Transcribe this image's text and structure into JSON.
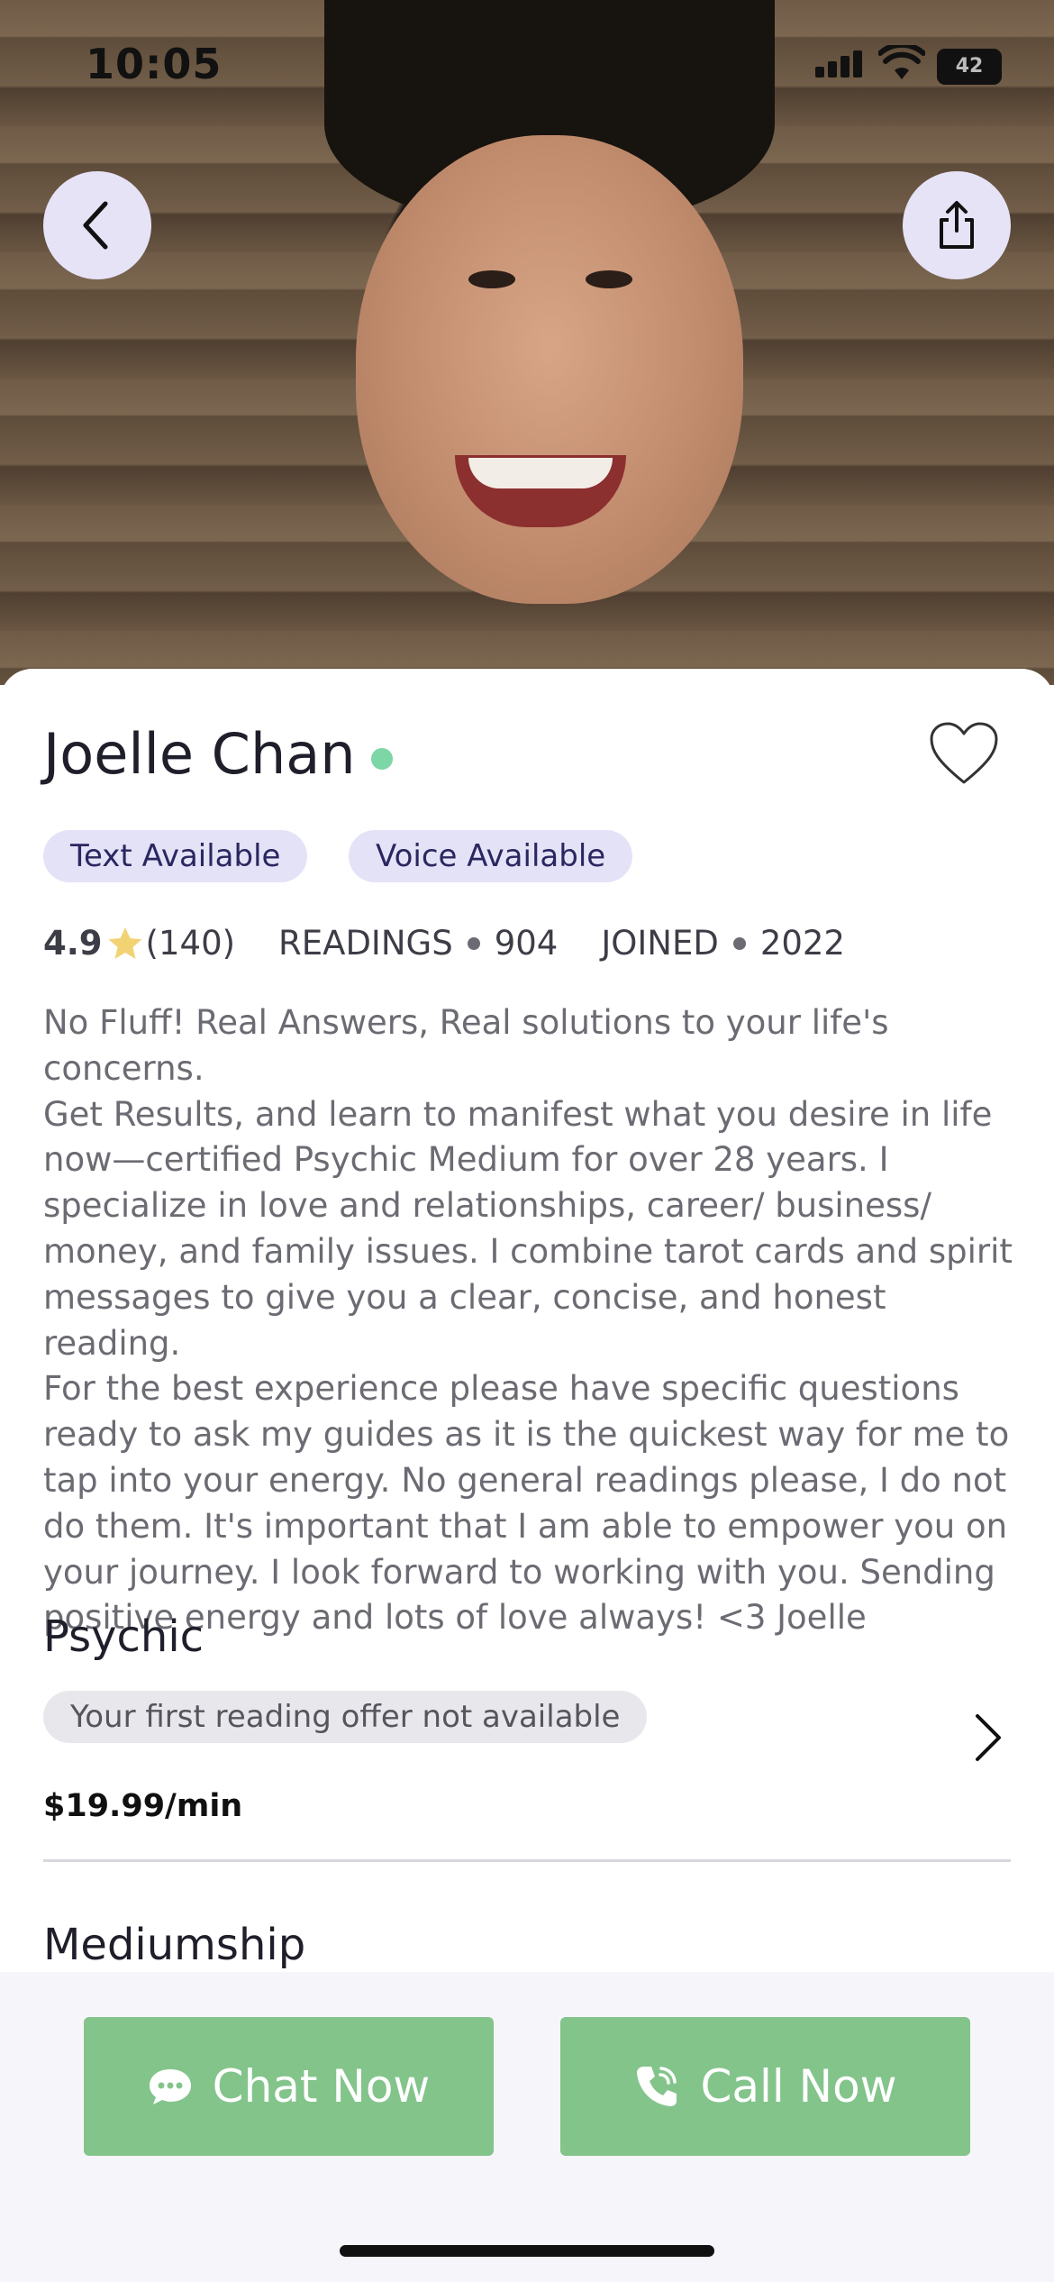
{
  "status_bar": {
    "time": "10:05",
    "battery": "42"
  },
  "header": {
    "back_icon": "chevron-left-icon",
    "share_icon": "share-icon"
  },
  "profile": {
    "name": "Joelle Chan",
    "online": true,
    "favorite_icon": "heart-outline-icon",
    "tags": [
      "Text Available",
      "Voice Available"
    ],
    "rating": "4.9",
    "review_count": "(140)",
    "readings_label": "READINGS",
    "readings_value": "904",
    "joined_label": "JOINED",
    "joined_value": "2022",
    "bio": "No Fluff! Real Answers, Real solutions to your life's concerns.\nGet Results, and learn to manifest what you desire in life\nnow—certified Psychic Medium for over 28 years. I\nspecialize in love and relationships, career/ business/\nmoney, and family issues. I combine tarot cards and spirit\nmessages to give you a clear, concise, and honest reading.\nFor the best experience please have specific questions\nready to ask my guides as it is the quickest way for me to\ntap into your energy.  No general readings please, I do not\ndo them. It's important that I am able to empower you on\nyour journey.  I look forward to working with you. Sending\npositive energy and lots of love always!  <3 Joelle"
  },
  "services": [
    {
      "title": "Psychic",
      "offer": "Your first reading offer not available",
      "price": "$19.99/min"
    },
    {
      "title": "Mediumship"
    }
  ],
  "actions": {
    "chat_label": "Chat Now",
    "call_label": "Call Now"
  },
  "colors": {
    "accent_green": "#83c48b",
    "chip_bg": "#e4e2f7",
    "online": "#7cd6a5"
  }
}
